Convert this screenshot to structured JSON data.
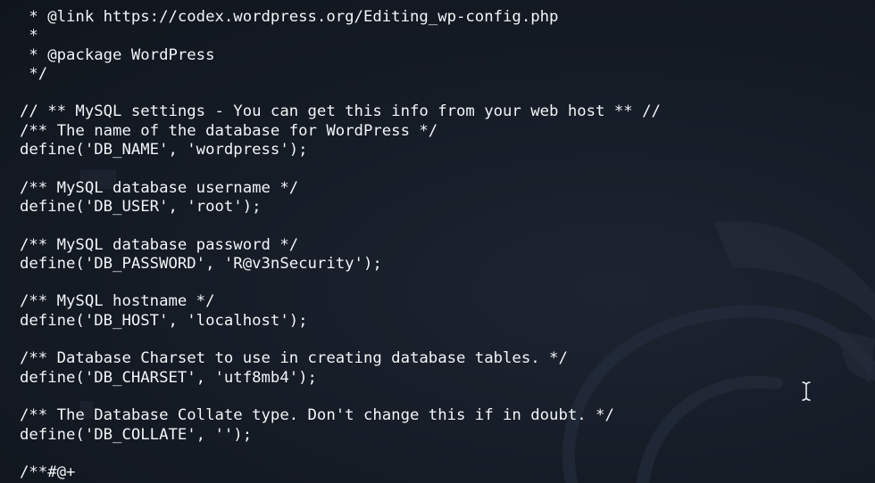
{
  "terminal": {
    "lines": [
      " * @link https://codex.wordpress.org/Editing_wp-config.php",
      " *",
      " * @package WordPress",
      " */",
      "",
      "// ** MySQL settings - You can get this info from your web host ** //",
      "/** The name of the database for WordPress */",
      "define('DB_NAME', 'wordpress');",
      "",
      "/** MySQL database username */",
      "define('DB_USER', 'root');",
      "",
      "/** MySQL database password */",
      "define('DB_PASSWORD', 'R@v3nSecurity');",
      "",
      "/** MySQL hostname */",
      "define('DB_HOST', 'localhost');",
      "",
      "/** Database Charset to use in creating database tables. */",
      "define('DB_CHARSET', 'utf8mb4');",
      "",
      "/** The Database Collate type. Don't change this if in doubt. */",
      "define('DB_COLLATE', '');",
      "",
      "/**#@+"
    ]
  },
  "colors": {
    "background": "#141a24",
    "text": "#f2f4f7",
    "watermark": "#2a3140"
  },
  "icons": {
    "cursor": "text-cursor-icon",
    "watermark": "dragon-watermark-icon"
  }
}
